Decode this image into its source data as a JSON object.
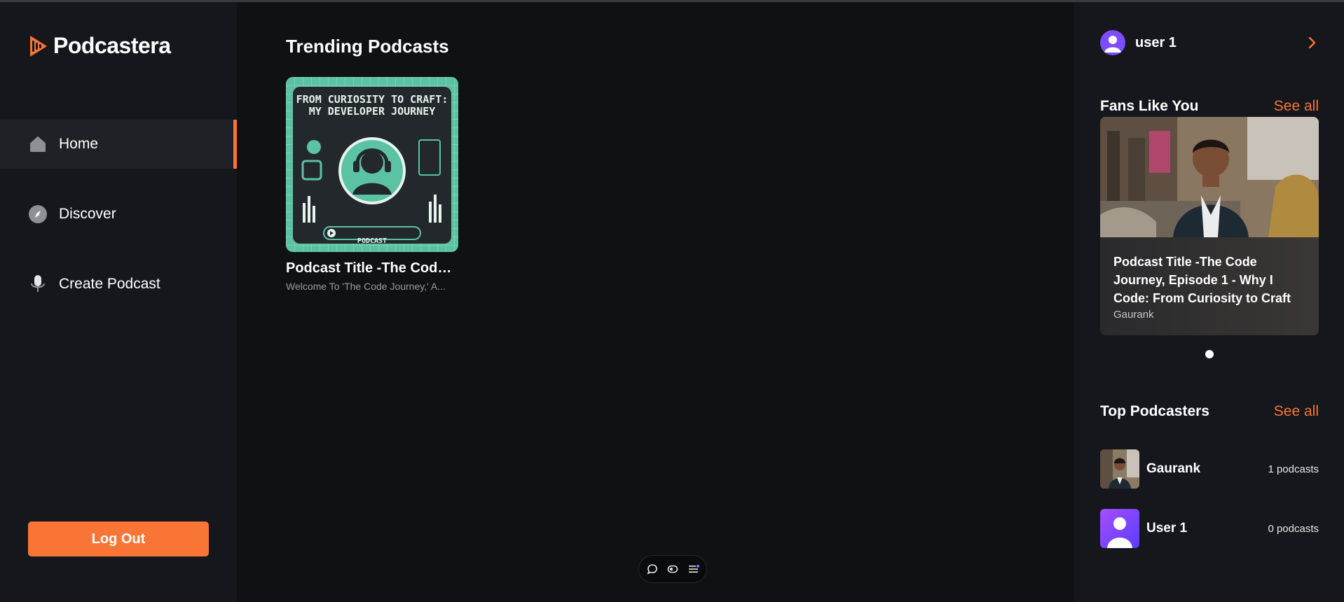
{
  "app": {
    "name": "Podcastera"
  },
  "nav": {
    "items": [
      {
        "label": "Home",
        "icon": "home-icon",
        "active": true
      },
      {
        "label": "Discover",
        "icon": "compass-icon",
        "active": false
      },
      {
        "label": "Create Podcast",
        "icon": "microphone-icon",
        "active": false
      }
    ],
    "logout_label": "Log Out"
  },
  "main": {
    "trending_title": "Trending Podcasts",
    "podcasts": [
      {
        "title": "Podcast Title -The Code Journey",
        "description": "Welcome To 'The Code Journey,' A...",
        "cover_text": "FROM CURIOSITY TO CRAFT: MY DEVELOPER JOURNEY",
        "cover_badge": "PODCAST"
      }
    ]
  },
  "user": {
    "name": "user 1"
  },
  "fans": {
    "title": "Fans Like You",
    "see_all": "See all",
    "featured": {
      "title": "Podcast Title -The Code Journey, Episode 1 - Why I Code: From Curiosity to Craft",
      "author": "Gaurank"
    }
  },
  "top_podcasters": {
    "title": "Top Podcasters",
    "see_all": "See all",
    "items": [
      {
        "name": "Gaurank",
        "count": "1 podcasts"
      },
      {
        "name": "User 1",
        "count": "0 podcasts"
      }
    ]
  },
  "colors": {
    "accent": "#f97535",
    "background": "#101114",
    "panel": "#15171c",
    "cover": "#5cc2a4"
  }
}
